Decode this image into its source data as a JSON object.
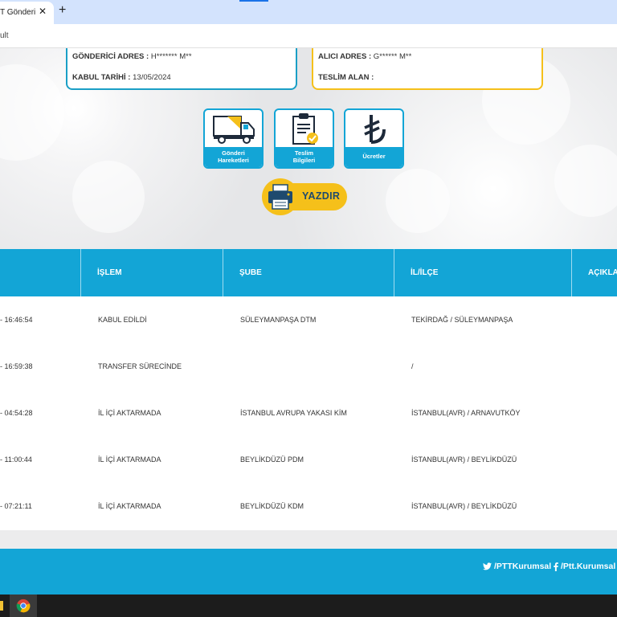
{
  "browser": {
    "tab_title": "T Gönderi",
    "tab_close": "✕",
    "new_tab": "+",
    "address_fragment": "ult"
  },
  "sender_card": {
    "address_label": "GÖNDERİCİ ADRES :",
    "address_value": "H******* M**",
    "date_label": "KABUL TARİHİ :",
    "date_value": "13/05/2024"
  },
  "receiver_card": {
    "address_label": "ALICI ADRES :",
    "address_value": "G****** M**",
    "delivered_label": "TESLİM ALAN :",
    "delivered_value": ""
  },
  "action_buttons": [
    {
      "label_line1": "Gönderi",
      "label_line2": "Hareketleri",
      "icon": "truck-icon"
    },
    {
      "label_line1": "Teslim",
      "label_line2": "Bilgileri",
      "icon": "clipboard-check-icon"
    },
    {
      "label_line1": "Ücretler",
      "label_line2": "",
      "icon": "lira-icon"
    }
  ],
  "print_button": {
    "label": "YAZDIR",
    "icon": "printer-icon"
  },
  "table": {
    "headers": [
      "",
      "İŞLEM",
      "ŞUBE",
      "İL/İLÇE",
      "AÇIKLA"
    ],
    "rows": [
      {
        "time": "- 16:46:54",
        "action": "KABUL EDİLDİ",
        "branch": "SÜLEYMANPAŞA DTM",
        "location": "TEKİRDAĞ / SÜLEYMANPAŞA"
      },
      {
        "time": "- 16:59:38",
        "action": "TRANSFER SÜRECİNDE",
        "branch": "",
        "location": "/"
      },
      {
        "time": "- 04:54:28",
        "action": "İL İÇİ AKTARMADA",
        "branch": "İSTANBUL AVRUPA YAKASI KİM",
        "location": "İSTANBUL(AVR) / ARNAVUTKÖY"
      },
      {
        "time": "- 11:00:44",
        "action": "İL İÇİ AKTARMADA",
        "branch": "BEYLİKDÜZÜ PDM",
        "location": "İSTANBUL(AVR) / BEYLİKDÜZÜ"
      },
      {
        "time": "- 07:21:11",
        "action": "İL İÇİ AKTARMADA",
        "branch": "BEYLİKDÜZÜ KDM",
        "location": "İSTANBUL(AVR) / BEYLİKDÜZÜ"
      }
    ]
  },
  "footer": {
    "twitter": "/PTTKurumsal",
    "facebook": "/Ptt.Kurumsal"
  },
  "colors": {
    "primary": "#13a5d6",
    "accent": "#f5c01a",
    "dark": "#1e4a6e"
  }
}
